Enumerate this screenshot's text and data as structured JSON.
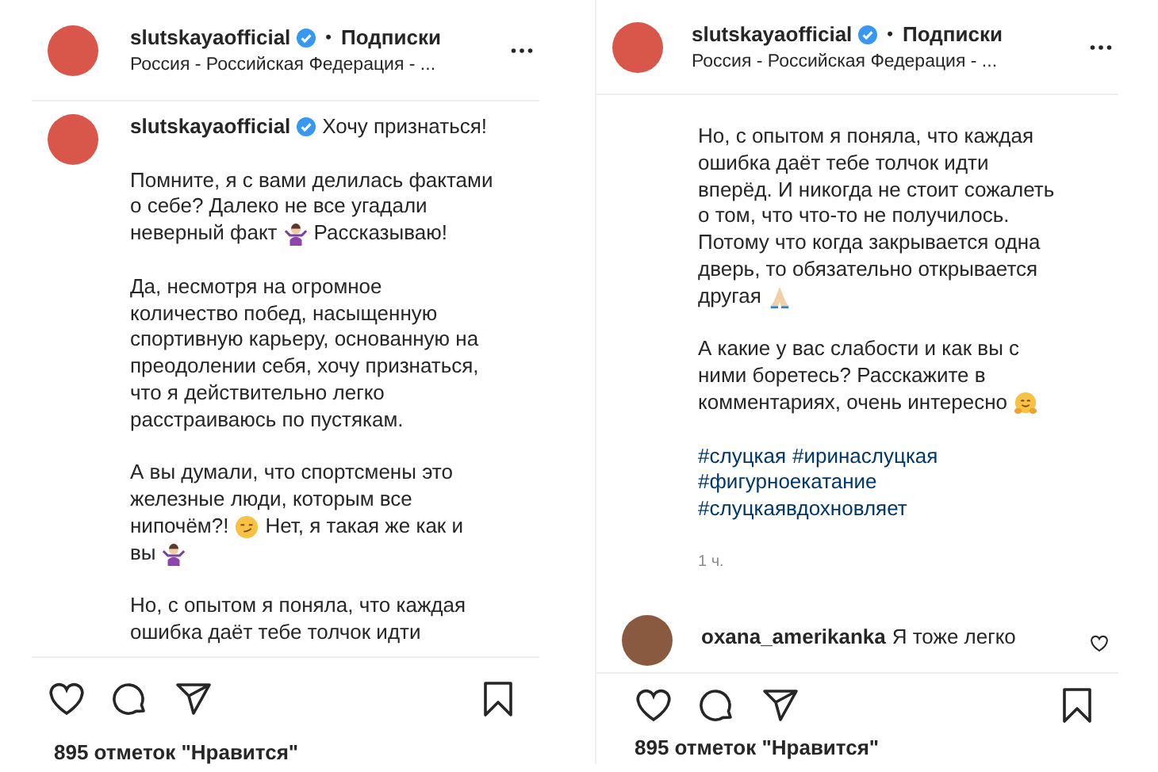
{
  "posts": [
    {
      "header": {
        "username": "slutskayaofficial",
        "verified": true,
        "separator": "•",
        "follow": "Подписки",
        "location": "Россия - Российская Федерация - ..."
      },
      "caption": {
        "author": {
          "username": "slutskayaofficial",
          "verified": true,
          "text": "Хочу признаться!"
        },
        "paragraphs": [
          [
            [
              {
                "kind": "text",
                "text": "Помните, я с вами делилась фактами"
              }
            ],
            [
              {
                "kind": "text",
                "text": "о себе? Далеко не все угадали"
              }
            ],
            [
              {
                "kind": "text",
                "text": "неверный факт"
              },
              {
                "kind": "shrug"
              },
              {
                "kind": "text",
                "text": "Рассказываю!"
              }
            ]
          ],
          [
            [
              {
                "kind": "text",
                "text": "Да, несмотря на огромное"
              }
            ],
            [
              {
                "kind": "text",
                "text": "количество побед, насыщенную"
              }
            ],
            [
              {
                "kind": "text",
                "text": "спортивную карьеру, основанную на"
              }
            ],
            [
              {
                "kind": "text",
                "text": "преодолении себя, хочу признаться,"
              }
            ],
            [
              {
                "kind": "text",
                "text": "что я действительно легко"
              }
            ],
            [
              {
                "kind": "text",
                "text": "расстраиваюсь по пустякам."
              }
            ]
          ],
          [
            [
              {
                "kind": "text",
                "text": "А вы думали, что спортсмены это"
              }
            ],
            [
              {
                "kind": "text",
                "text": "железные люди, которым все"
              }
            ],
            [
              {
                "kind": "text",
                "text": "нипочём?!"
              },
              {
                "kind": "smirk"
              },
              {
                "kind": "text",
                "text": "Нет, я такая же как и"
              }
            ],
            [
              {
                "kind": "text",
                "text": "вы"
              },
              {
                "kind": "shrug"
              }
            ]
          ],
          [
            [
              {
                "kind": "text",
                "text": "Но, с опытом я поняла, что каждая"
              }
            ],
            [
              {
                "kind": "text",
                "text": "ошибка даёт тебе толчок идти"
              }
            ]
          ]
        ]
      },
      "likes": "895 отметок \"Нравится\""
    },
    {
      "header": {
        "username": "slutskayaofficial",
        "verified": true,
        "separator": "•",
        "follow": "Подписки",
        "location": "Россия - Российская Федерация - ..."
      },
      "caption": {
        "paragraphs": [
          [
            [
              {
                "kind": "text",
                "text": "Но, с опытом я поняла, что каждая"
              }
            ],
            [
              {
                "kind": "text",
                "text": "ошибка даёт тебе толчок идти"
              }
            ],
            [
              {
                "kind": "text",
                "text": "вперёд. И никогда не стоит сожалеть"
              }
            ],
            [
              {
                "kind": "text",
                "text": "о том, что что-то не получилось."
              }
            ],
            [
              {
                "kind": "text",
                "text": "Потому что когда закрывается одна"
              }
            ],
            [
              {
                "kind": "text",
                "text": "дверь, то обязательно открывается"
              }
            ],
            [
              {
                "kind": "text",
                "text": "другая"
              },
              {
                "kind": "pray"
              }
            ]
          ],
          [
            [
              {
                "kind": "text",
                "text": "А какие у вас слабости и как вы с"
              }
            ],
            [
              {
                "kind": "text",
                "text": "ними боретесь? Расскажите в"
              }
            ],
            [
              {
                "kind": "text",
                "text": "комментариях, очень интересно"
              },
              {
                "kind": "hug"
              }
            ]
          ]
        ],
        "hashtags": [
          [
            "#слуцкая",
            "#иринаслуцкая"
          ],
          [
            "#фигурноекатание"
          ],
          [
            "#слуцкаявдохновляет"
          ]
        ],
        "time": "1 ч.",
        "comment": {
          "username": "oxana_amerikanka",
          "text": "Я тоже легко"
        }
      },
      "likes": "895 отметок \"Нравится\""
    }
  ]
}
